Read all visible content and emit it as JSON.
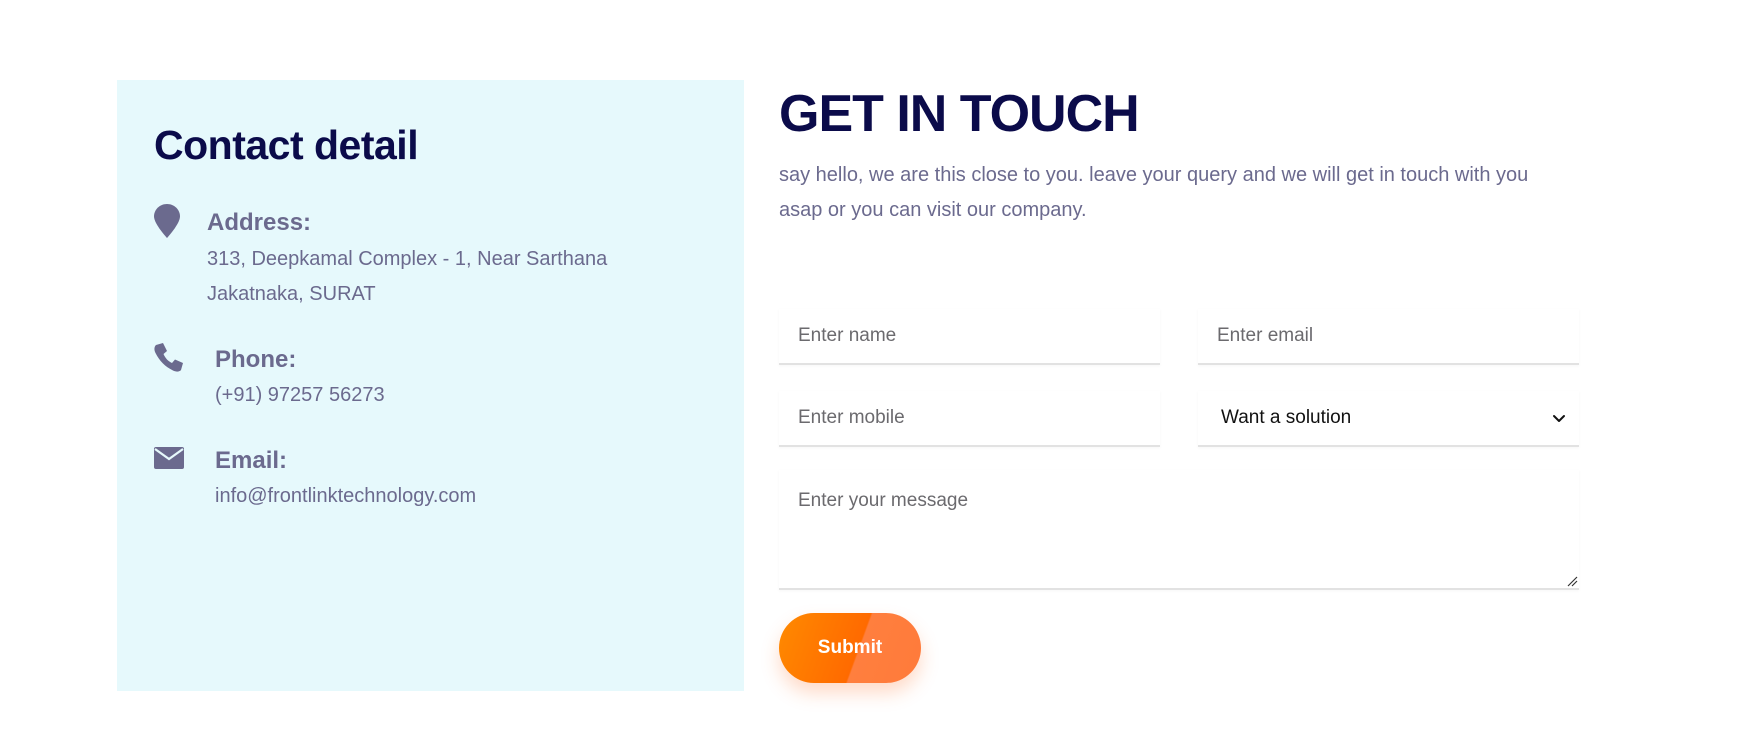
{
  "contact": {
    "title": "Contact detail",
    "address": {
      "label": "Address:",
      "line1": "313, Deepkamal Complex - 1, Near Sarthana",
      "line2": "Jakatnaka, SURAT",
      "icon": "map-pin-icon"
    },
    "phone": {
      "label": "Phone:",
      "value": "(+91) 97257 56273",
      "icon": "phone-icon"
    },
    "email": {
      "label": "Email:",
      "value": "info@frontlinktechnology.com",
      "icon": "envelope-icon"
    }
  },
  "form": {
    "title": "GET IN TOUCH",
    "description": "say hello, we are this close to you. leave your query and we will get in touch with you asap or you can visit our company.",
    "name_placeholder": "Enter name",
    "email_placeholder": "Enter email",
    "mobile_placeholder": "Enter mobile",
    "select_value": "Want a solution",
    "message_placeholder": "Enter your message",
    "submit_label": "Submit"
  },
  "colors": {
    "panel_background": "#e6f9fc",
    "heading": "#0b0b4a",
    "body_text": "#6b6a8e",
    "accent": "#ff7a00"
  }
}
